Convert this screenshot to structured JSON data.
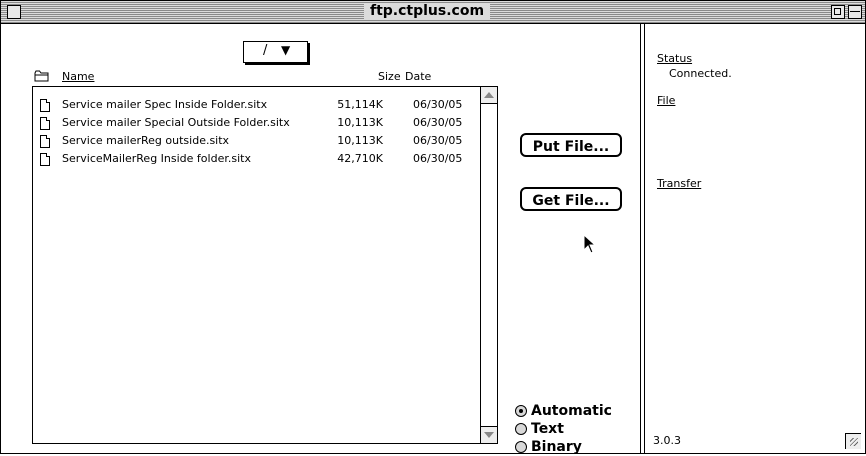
{
  "window": {
    "title": "ftp.ctplus.com"
  },
  "browser": {
    "path": "/",
    "columns": {
      "name": "Name",
      "size": "Size",
      "date": "Date"
    },
    "files": [
      {
        "name": "Service mailer Spec Inside Folder.sitx",
        "size": "51,114K",
        "date": "06/30/05"
      },
      {
        "name": "Service mailer Special Outside Folder.sitx",
        "size": "10,113K",
        "date": "06/30/05"
      },
      {
        "name": "Service mailerReg outside.sitx",
        "size": "10,113K",
        "date": "06/30/05"
      },
      {
        "name": "ServiceMailerReg Inside folder.sitx",
        "size": "42,710K",
        "date": "06/30/05"
      }
    ]
  },
  "actions": {
    "put_label": "Put File...",
    "get_label": "Get File..."
  },
  "mode": {
    "options": [
      "Automatic",
      "Text",
      "Binary"
    ],
    "selected": "Automatic"
  },
  "info": {
    "status_label": "Status",
    "status_value": "Connected.",
    "file_label": "File",
    "transfer_label": "Transfer",
    "version": "3.0.3"
  }
}
